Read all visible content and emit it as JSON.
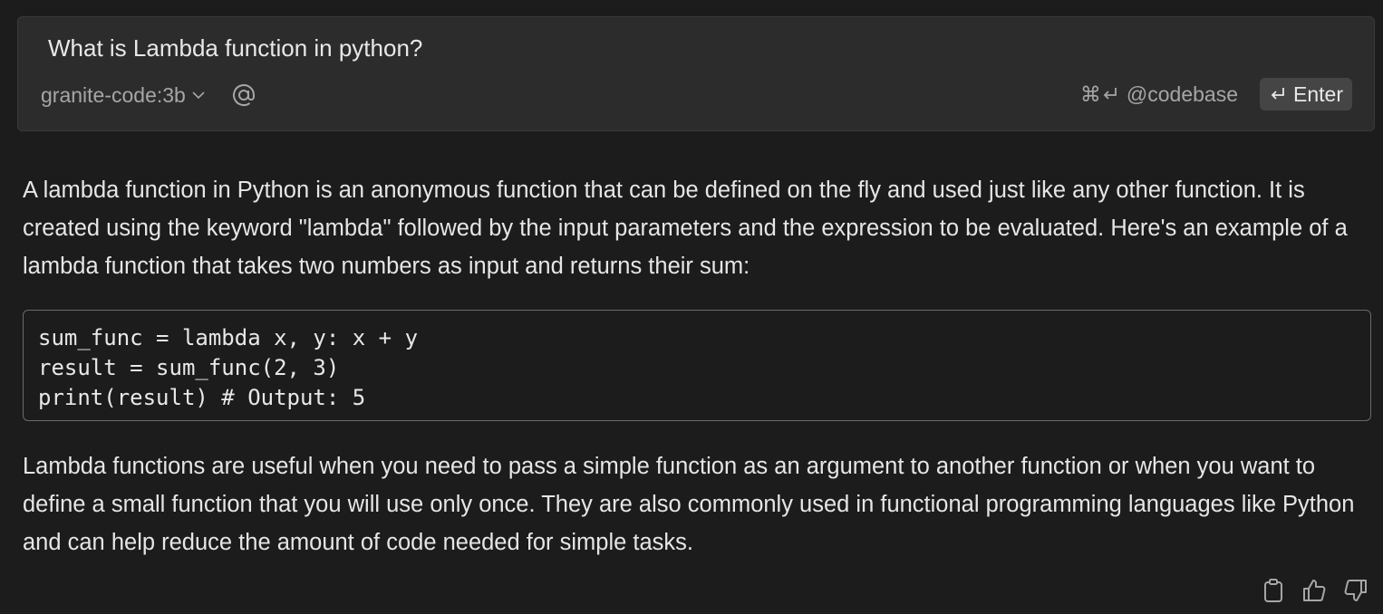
{
  "input": {
    "query": "What is Lambda function in python?",
    "model": "granite-code:3b",
    "codebase_shortcut": "⌘",
    "codebase_label": "@codebase",
    "enter_label": "Enter"
  },
  "response": {
    "paragraph1": "A lambda function in Python is an anonymous function that can be defined on the fly and used just like any other function. It is created using the keyword \"lambda\" followed by the input parameters and the expression to be evaluated. Here's an example of a lambda function that takes two numbers as input and returns their sum:",
    "code_lines": [
      "sum_func = lambda x, y: x + y",
      "result = sum_func(2, 3)",
      "print(result) # Output: 5"
    ],
    "paragraph2": "Lambda functions are useful when you need to pass a simple function as an argument to another function or when you want to define a small function that you will use only once. They are also commonly used in functional programming languages like Python and can help reduce the amount of code needed for simple tasks."
  },
  "icons": {
    "model_dropdown": "chevron-down-icon",
    "mention": "at-sign-icon",
    "command": "command-key-icon",
    "return": "return-icon",
    "copy": "clipboard-icon",
    "like": "thumbs-up-icon",
    "dislike": "thumbs-down-icon"
  }
}
